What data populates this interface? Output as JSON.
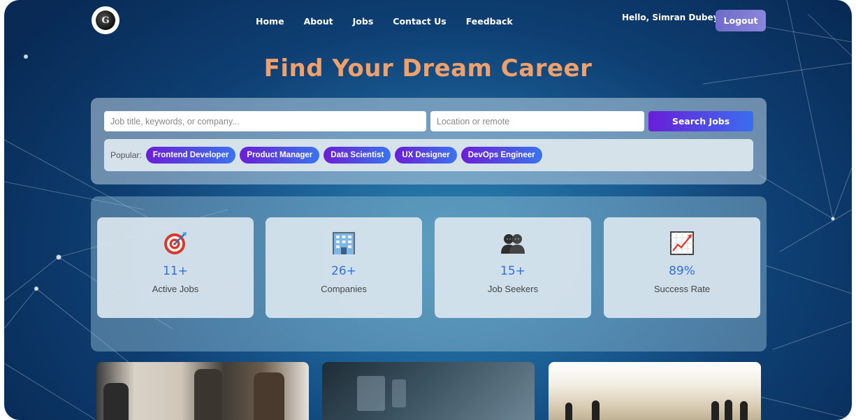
{
  "nav": {
    "links": [
      "Home",
      "About",
      "Jobs",
      "Contact Us",
      "Feedback"
    ],
    "greeting": "Hello, Simran Dubey",
    "logout_label": "Logout"
  },
  "hero": {
    "title": "Find Your Dream Career"
  },
  "search": {
    "job_placeholder": "Job title, keywords, or company...",
    "location_placeholder": "Location or remote",
    "button_label": "Search Jobs",
    "popular_label": "Popular:",
    "popular_tags": [
      "Frontend Developer",
      "Product Manager",
      "Data Scientist",
      "UX Designer",
      "DevOps Engineer"
    ]
  },
  "stats": [
    {
      "icon": "target-icon",
      "value": "11+",
      "label": "Active Jobs"
    },
    {
      "icon": "building-icon",
      "value": "26+",
      "label": "Companies"
    },
    {
      "icon": "people-icon",
      "value": "15+",
      "label": "Job Seekers"
    },
    {
      "icon": "chart-increasing-icon",
      "value": "89%",
      "label": "Success Rate"
    }
  ],
  "colors": {
    "title_accent": "#f0a06b",
    "button_gradient_start": "#6a1ed8",
    "button_gradient_end": "#3b6ef0",
    "stat_number": "#2f6fe0",
    "logout_bg": "#7c79d2"
  }
}
